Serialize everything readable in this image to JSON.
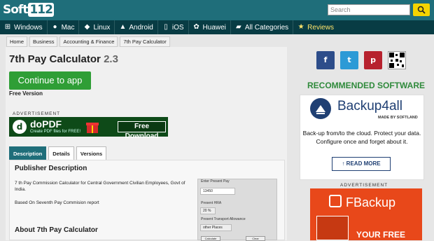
{
  "header": {
    "logo_text": "Soft",
    "logo_num": "112",
    "search_placeholder": "Search"
  },
  "nav": {
    "items": [
      {
        "label": "Windows",
        "icon": "windows-icon"
      },
      {
        "label": "Mac",
        "icon": "apple-icon"
      },
      {
        "label": "Linux",
        "icon": "linux-icon"
      },
      {
        "label": "Android",
        "icon": "android-icon"
      },
      {
        "label": "iOS",
        "icon": "ios-icon"
      },
      {
        "label": "Huawei",
        "icon": "huawei-icon"
      },
      {
        "label": "All Categories",
        "icon": "folder-icon"
      },
      {
        "label": "Reviews",
        "icon": "star-icon"
      }
    ]
  },
  "breadcrumb": [
    "Home",
    "Business",
    "Accounting & Finance",
    "7th Pay Calculator"
  ],
  "app": {
    "name": "7th Pay Calculator",
    "version": "2.3",
    "continue_label": "Continue to app",
    "license": "Free Version"
  },
  "ad1": {
    "label": "ADVERTISEMENT",
    "brand": "doPDF",
    "tagline": "Create PDF files for FREE!",
    "cta": "Free Download"
  },
  "tabs": [
    "Description",
    "Details",
    "Versions"
  ],
  "description": {
    "publisher_heading": "Publisher Description",
    "publisher_text": "7 th Pay Commission Calculator for Central Government Civilian Employees, Govt of India.",
    "publisher_text2": "Based On Seventh Pay Commision report",
    "about_heading": "About 7th Pay Calculator"
  },
  "screenshot": {
    "field1_label": "Enter Present Pay",
    "field1_value": "13450",
    "field2_label": "Present HRA",
    "field2_value": "20 %",
    "field3_label": "Present Transport Allowance",
    "field3_value": "other Places",
    "btn1": "Calculate",
    "btn2": "Clear"
  },
  "social": {
    "facebook": "f",
    "twitter": "t",
    "pinterest": "p"
  },
  "recommended": {
    "heading": "RECOMMENDED SOFTWARE",
    "product": "Backup4all",
    "made_by": "MADE BY SOFTLAND",
    "desc": "Back-up from/to the cloud. Protect your data. Configure once and forget about it.",
    "read_more": "READ MORE"
  },
  "ad2": {
    "label": "ADVERTISEMENT",
    "brand": "FBackup",
    "tagline": "YOUR FREE"
  },
  "colors": {
    "header": "#1f6e7a",
    "nav": "#083c44",
    "continue": "#2f9e36",
    "recommended": "#2f8a3b",
    "search_button": "#f5d400"
  }
}
